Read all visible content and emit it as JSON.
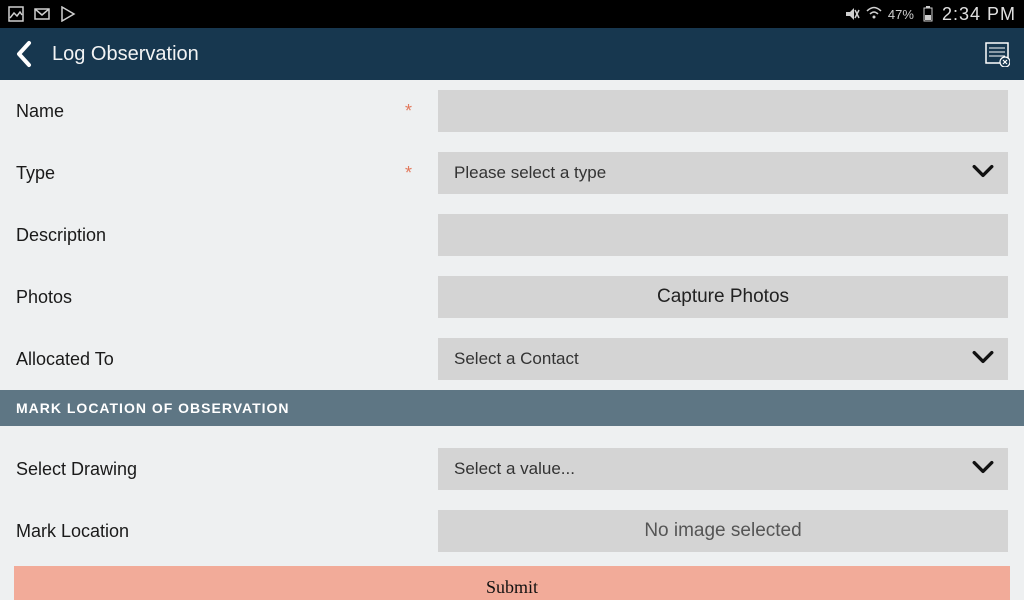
{
  "status": {
    "battery_pct": "47%",
    "time": "2:34 PM"
  },
  "header": {
    "title": "Log Observation"
  },
  "form": {
    "name_label": "Name",
    "type_label": "Type",
    "type_placeholder": "Please select a type",
    "description_label": "Description",
    "photos_label": "Photos",
    "photos_button": "Capture Photos",
    "allocated_label": "Allocated To",
    "allocated_placeholder": "Select a Contact",
    "section_header": "MARK LOCATION OF OBSERVATION",
    "drawing_label": "Select Drawing",
    "drawing_placeholder": "Select a value...",
    "mark_label": "Mark Location",
    "mark_placeholder": "No image selected",
    "submit_label": "Submit"
  }
}
